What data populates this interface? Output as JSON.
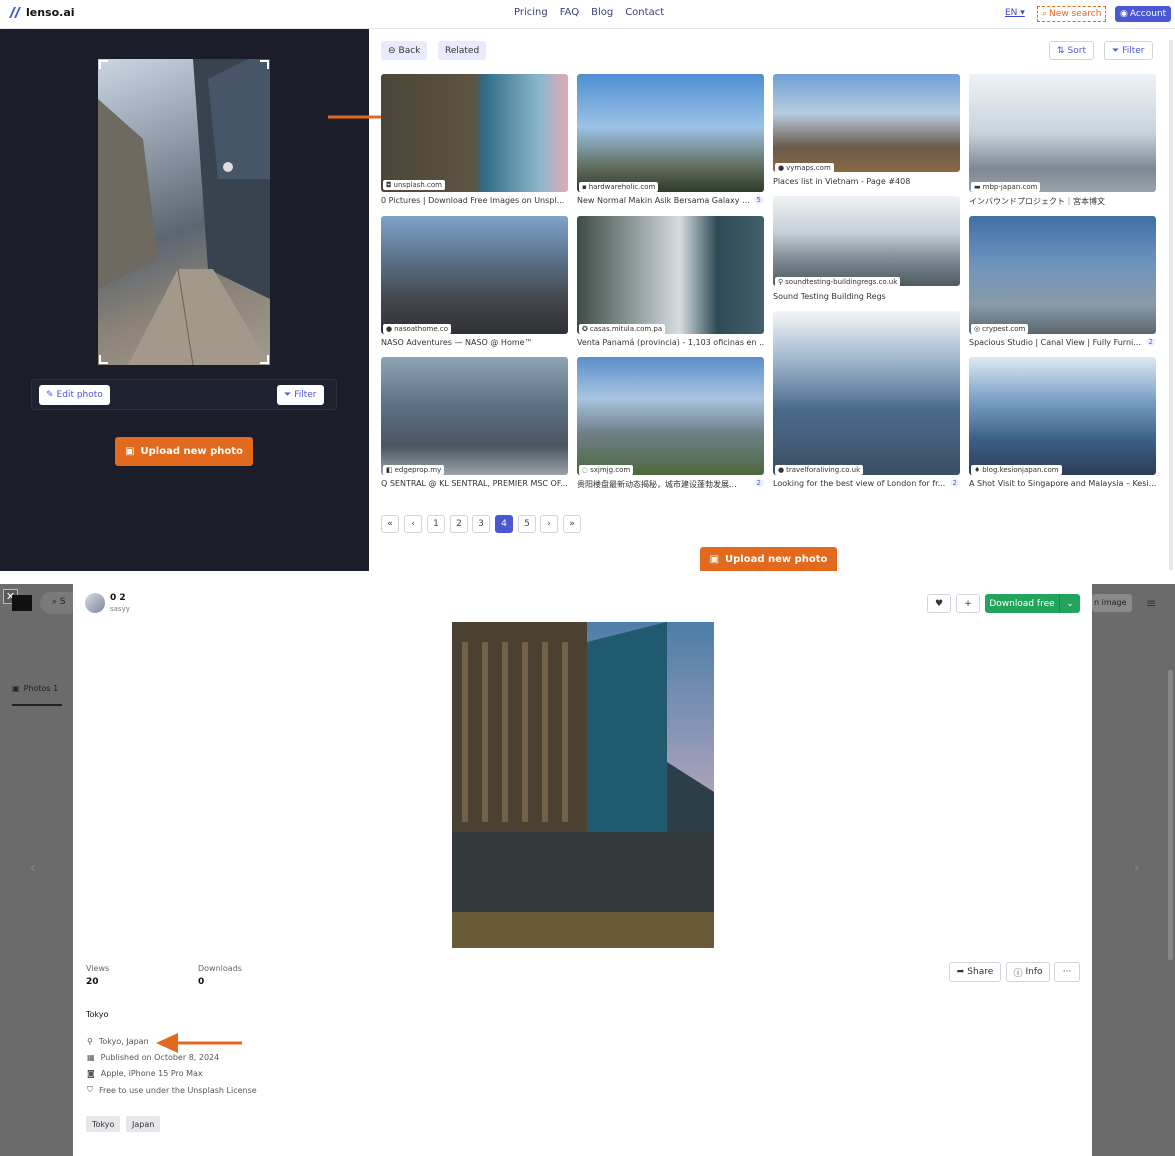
{
  "nav": {
    "logo": "lenso.ai",
    "links": [
      "Pricing",
      "FAQ",
      "Blog",
      "Contact"
    ],
    "lang": "EN",
    "new_search": "New search",
    "account": "Account"
  },
  "left": {
    "edit_photo": "Edit photo",
    "filter": "Filter",
    "upload": "Upload new photo"
  },
  "results": {
    "back": "Back",
    "related": "Related",
    "sort": "Sort",
    "filter": "Filter",
    "cards": [
      {
        "source": "unsplash.com",
        "title": "0 Pictures | Download Free Images on Unspl...",
        "count": ""
      },
      {
        "source": "hardwareholic.com",
        "title": "New Normal Makin Asik Bersama Galaxy ...",
        "count": "5"
      },
      {
        "source": "vymaps.com",
        "title": "Places list in Vietnam - Page #408",
        "count": ""
      },
      {
        "source": "mbp-japan.com",
        "title": "インバウンドプロジェクト｜宮本博文",
        "count": ""
      },
      {
        "source": "nasoathome.co",
        "title": "NASO Adventures — NASO @ Home™",
        "count": ""
      },
      {
        "source": "casas.mitula.com.pa",
        "title": "Venta Panamá (provincia) - 1,103 oficinas en ...",
        "count": ""
      },
      {
        "source": "soundtesting-buildingregs.co.uk",
        "title": "Sound Testing Building Regs",
        "count": ""
      },
      {
        "source": "crypest.com",
        "title": "Spacious Studio | Canal View | Fully Furni...",
        "count": "2"
      },
      {
        "source": "edgeprop.my",
        "title": "Q SENTRAL @ KL SENTRAL, PREMIER MSC OF...",
        "count": ""
      },
      {
        "source": "sxjmjg.com",
        "title": "贵阳楼盘最新动态揭秘，城市建设蓬勃发展...",
        "count": "2"
      },
      {
        "source": "travelforaliving.co.uk",
        "title": "Looking for the best view of London for fr...",
        "count": "2"
      },
      {
        "source": "blog.kesionjapan.com",
        "title": "A Shot Visit to Singapore and Malaysia – Kesi...",
        "count": ""
      }
    ],
    "pages": [
      "«",
      "‹",
      "1",
      "2",
      "3",
      "4",
      "5",
      "›",
      "»"
    ],
    "upload": "Upload new photo"
  },
  "modal": {
    "user_name": "0 2",
    "user_handle": "sasyy",
    "download": "Download free",
    "bg_tab": "Photos 1",
    "bg_search_btn": "n image",
    "views_label": "Views",
    "views_value": "20",
    "downloads_label": "Downloads",
    "downloads_value": "0",
    "share": "Share",
    "info": "Info",
    "more": "···",
    "description": "Tokyo",
    "location": "Tokyo, Japan",
    "published": "Published on October 8, 2024",
    "camera": "Apple, iPhone 15 Pro Max",
    "license": "Free to use under the Unsplash License",
    "tags": [
      "Tokyo",
      "Japan"
    ]
  },
  "colors": {
    "accent": "#4a58d6",
    "orange": "#e16a1e",
    "green": "#22a45d",
    "dark_panel": "#1b1e29"
  }
}
